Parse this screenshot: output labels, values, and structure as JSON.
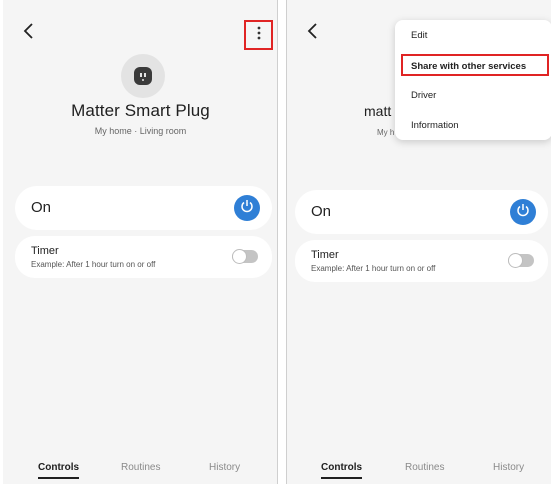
{
  "left_screen": {
    "device": {
      "title": "Matter Smart Plug",
      "location": "My home · Living room"
    },
    "power": {
      "state_label": "On"
    },
    "timer": {
      "title": "Timer",
      "description": "Example: After 1 hour turn on or off"
    },
    "nav": [
      "Controls",
      "Routines",
      "History"
    ]
  },
  "right_screen": {
    "device": {
      "title": "matt",
      "location": "My h"
    },
    "menu": {
      "items": [
        "Edit",
        "Share with other services",
        "Driver",
        "Information"
      ]
    },
    "power": {
      "state_label": "On"
    },
    "timer": {
      "title": "Timer",
      "description": "Example: After 1 hour turn on or off"
    },
    "nav": [
      "Controls",
      "Routines",
      "History"
    ]
  },
  "colors": {
    "accent": "#2f7fd6",
    "highlight_border": "#e02424",
    "background": "#f5f5f5"
  },
  "icons": [
    "back-arrow-icon",
    "more-vert-icon",
    "smart-plug-icon",
    "power-icon"
  ]
}
